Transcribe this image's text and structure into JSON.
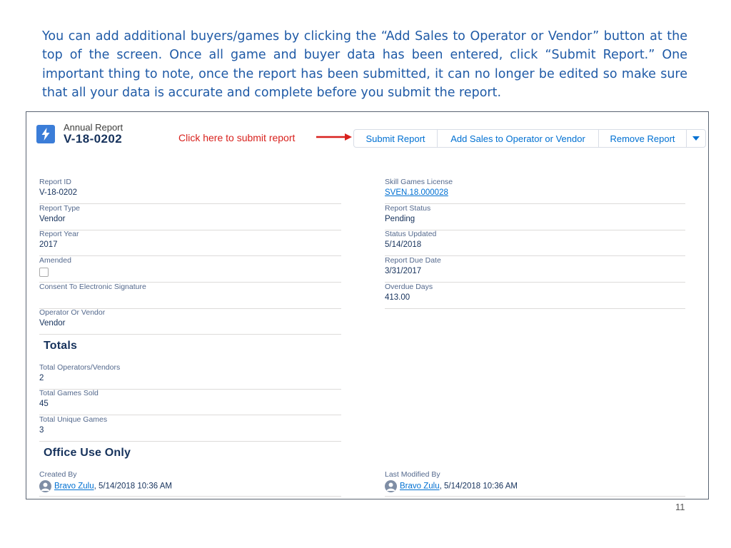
{
  "intro_text": "You can add additional buyers/games by clicking the “Add Sales to Operator or Vendor” button at the top of the screen.  Once all game and buyer data has been entered, click “Submit Report.”  One important thing to note, once the report has been submitted, it can no longer be edited so make sure that all your data is accurate and complete before you submit the report.",
  "header": {
    "record_type": "Annual Report",
    "record_name": "V-18-0202",
    "icon": "lightning-icon"
  },
  "callout_text": "Click here to submit report",
  "actions": {
    "submit": "Submit Report",
    "add_sales": "Add Sales to Operator or Vendor",
    "remove": "Remove Report",
    "more_icon": "chevron-down-icon"
  },
  "fields": {
    "report_id": {
      "label": "Report ID",
      "value": "V-18-0202"
    },
    "skill_license": {
      "label": "Skill Games License",
      "value": "SVEN.18.000028"
    },
    "report_type": {
      "label": "Report Type",
      "value": "Vendor"
    },
    "report_status": {
      "label": "Report Status",
      "value": "Pending"
    },
    "report_year": {
      "label": "Report Year",
      "value": "2017"
    },
    "status_updated": {
      "label": "Status Updated",
      "value": "5/14/2018"
    },
    "amended": {
      "label": "Amended",
      "checked": false
    },
    "report_due": {
      "label": "Report Due Date",
      "value": "3/31/2017"
    },
    "consent": {
      "label": "Consent To Electronic Signature",
      "value": ""
    },
    "overdue": {
      "label": "Overdue Days",
      "value": "413.00"
    },
    "operator_vendor": {
      "label": "Operator Or Vendor",
      "value": "Vendor"
    }
  },
  "totals": {
    "title": "Totals",
    "operators": {
      "label": "Total Operators/Vendors",
      "value": "2"
    },
    "games_sold": {
      "label": "Total Games Sold",
      "value": "45"
    },
    "unique_games": {
      "label": "Total Unique Games",
      "value": "3"
    }
  },
  "office": {
    "title": "Office Use Only",
    "created": {
      "label": "Created By",
      "user": "Bravo Zulu",
      "date": ", 5/14/2018 10:36 AM"
    },
    "modified": {
      "label": "Last Modified By",
      "user": "Bravo Zulu",
      "date": ", 5/14/2018 10:36 AM"
    }
  },
  "page_number": "11",
  "colors": {
    "accent": "#0070d2",
    "callout": "#d8211d",
    "intro": "#1f5aa6",
    "icon_bg": "#3b7dd8"
  }
}
